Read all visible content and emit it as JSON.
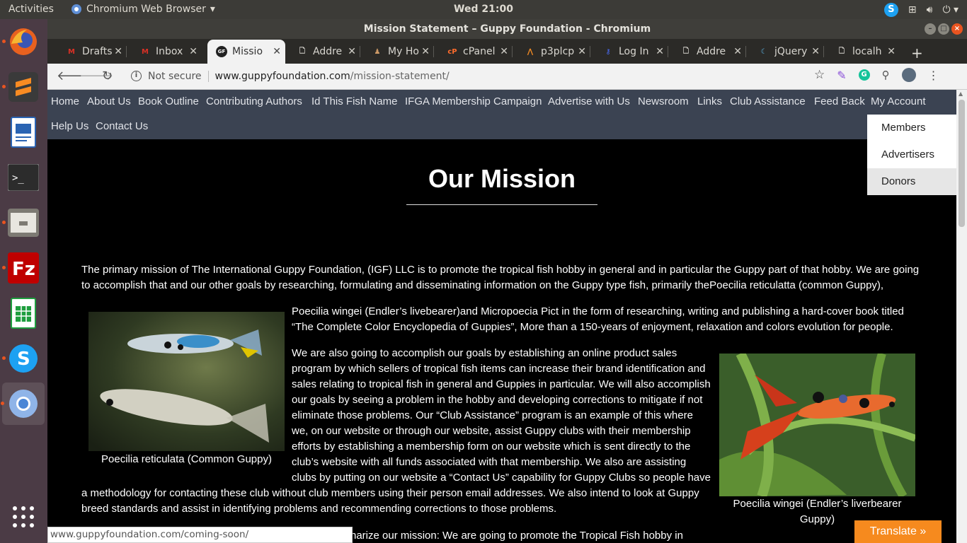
{
  "topbar": {
    "activities": "Activities",
    "app_name": "Chromium Web Browser",
    "clock": "Wed 21:00"
  },
  "window": {
    "title": "Mission Statement – Guppy Foundation - Chromium"
  },
  "tabs": [
    {
      "title": "Drafts",
      "icon": "gmail-icon"
    },
    {
      "title": "Inbox",
      "icon": "gmail-icon"
    },
    {
      "title": "Missio",
      "icon": "gf-icon"
    },
    {
      "title": "Addre",
      "icon": "page-icon"
    },
    {
      "title": "My Ho",
      "icon": "site-icon"
    },
    {
      "title": "cPanel",
      "icon": "cpanel-icon"
    },
    {
      "title": "p3plcp",
      "icon": "cpanel-tool-icon"
    },
    {
      "title": "Log In",
      "icon": "login-icon"
    },
    {
      "title": "Addre",
      "icon": "page-icon"
    },
    {
      "title": "jQuery",
      "icon": "jquery-icon"
    },
    {
      "title": "localh",
      "icon": "page-icon"
    }
  ],
  "address": {
    "security": "Not secure",
    "host": "www.guppyfoundation.com",
    "path": "/mission-statement/"
  },
  "menu": {
    "row1": [
      "Home",
      "About Us",
      "Book Outline",
      "Contributing Authors",
      "Id This Fish Name",
      "IFGA Membership Campaign",
      "Advertise with Us",
      "Newsroom",
      "Links",
      "Club Assistance",
      "Feed Back",
      "My Account"
    ],
    "row2": [
      "Help Us",
      "Contact Us"
    ],
    "dropdown": [
      "Members",
      "Advertisers",
      "Donors"
    ]
  },
  "content": {
    "heading": "Our Mission",
    "intro": [
      "The primary mission of The International Guppy Foundation, (IGF) LLC is to promote the tropical fish hobby in general and in particular the Guppy part of that hobby. We are going",
      "to accomplish that and our other goals by researching, formulating and disseminating information on the Guppy type fish, primarily thePoecilia reticulatta (common Guppy),"
    ],
    "para2": [
      "Poecilia wingei (Endler’s livebearer)and Micropoecia Pict in the form of researching, writing and publishing a hard-cover book titled",
      "“The Complete Color Encyclopedia of Guppies”, More than a 150-years of enjoyment, relaxation and colors evolution for people."
    ],
    "para3": [
      "We are also going to accomplish our goals by establishing an online product sales",
      "program by which sellers of tropical fish items can increase their brand identification and",
      "sales relating to tropical fish in general and Guppies in particular. We will also accomplish",
      "our goals by seeing a problem in the hobby and developing corrections to mitigate if not",
      "eliminate those problems. Our “Club Assistance” program is an example of this where",
      "we, on our website or through our website, assist Guppy clubs with their membership",
      "efforts by establishing a membership form on our website which is sent directly to the",
      "club’s website with all funds associated with that membership. We also are assisting",
      "clubs by putting on our website a “Contact Us” capability for Guppy Clubs so people have",
      "a methodology for contacting these club without club members using their person email addresses. We also intend to look at Guppy",
      "breed standards and assist in identifying problems and recommending corrections to those problems."
    ],
    "para4": "narize our mission: We are going to promote the Tropical Fish hobby in",
    "caption1": "Poecilia reticulata (Common Guppy)",
    "caption2_line1": "Poecilia wingei (Endler’s liverbearer",
    "caption2_line2": "Guppy)"
  },
  "status_url": "www.guppyfoundation.com/coming-soon/",
  "translate_button": "Translate »",
  "colors": {
    "menu_bg": "#3b4352",
    "translate": "#f68a1e",
    "ubuntu_orange": "#e95420"
  }
}
